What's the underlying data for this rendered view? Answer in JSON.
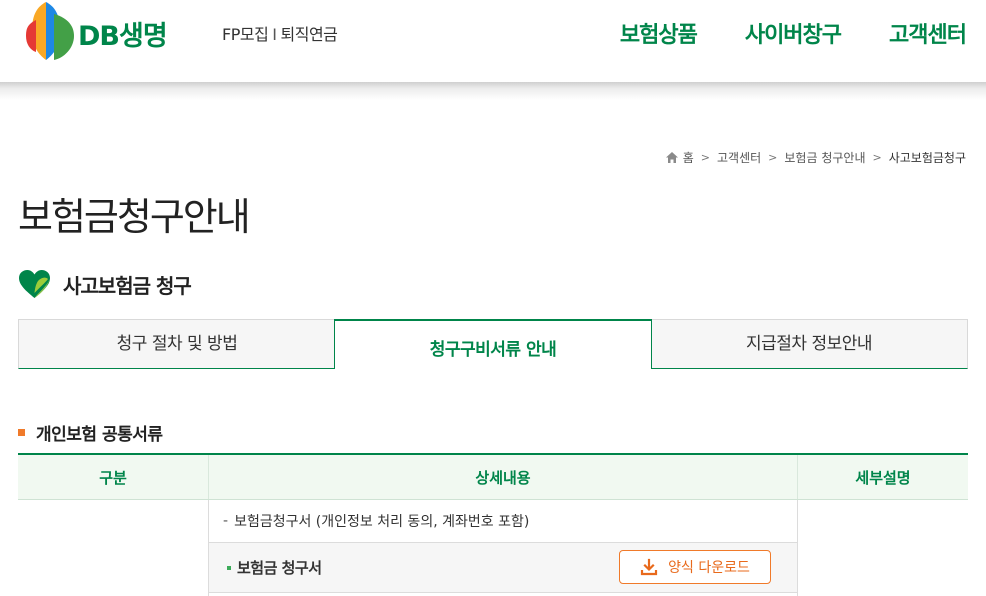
{
  "header": {
    "logo_text": "DB생명",
    "sub_links": [
      "FP모집",
      "퇴직연금"
    ],
    "sub_link_separator": "I",
    "gnb": [
      "보험상품",
      "사이버창구",
      "고객센터"
    ]
  },
  "breadcrumb": [
    "홈",
    "고객센터",
    "보험금 청구안내",
    "사고보험금청구"
  ],
  "page_title": "보험금청구안내",
  "section_title": "사고보험금 청구",
  "tabs": [
    "청구 절차 및 방법",
    "청구구비서류 안내",
    "지급절차 정보안내"
  ],
  "active_tab": 1,
  "subsection_title": "개인보험 공통서류",
  "table": {
    "headers": [
      "구분",
      "상세내용",
      "세부설명"
    ],
    "row_a_text": "보험금청구서 (개인정보 처리 동의, 계좌번호 포함)",
    "row_a_prefix": "-",
    "row_b_title": "보험금 청구서",
    "download_label": "양식 다운로드"
  },
  "colors": {
    "brand_green": "#00854a",
    "accent_orange": "#f07a2a"
  }
}
